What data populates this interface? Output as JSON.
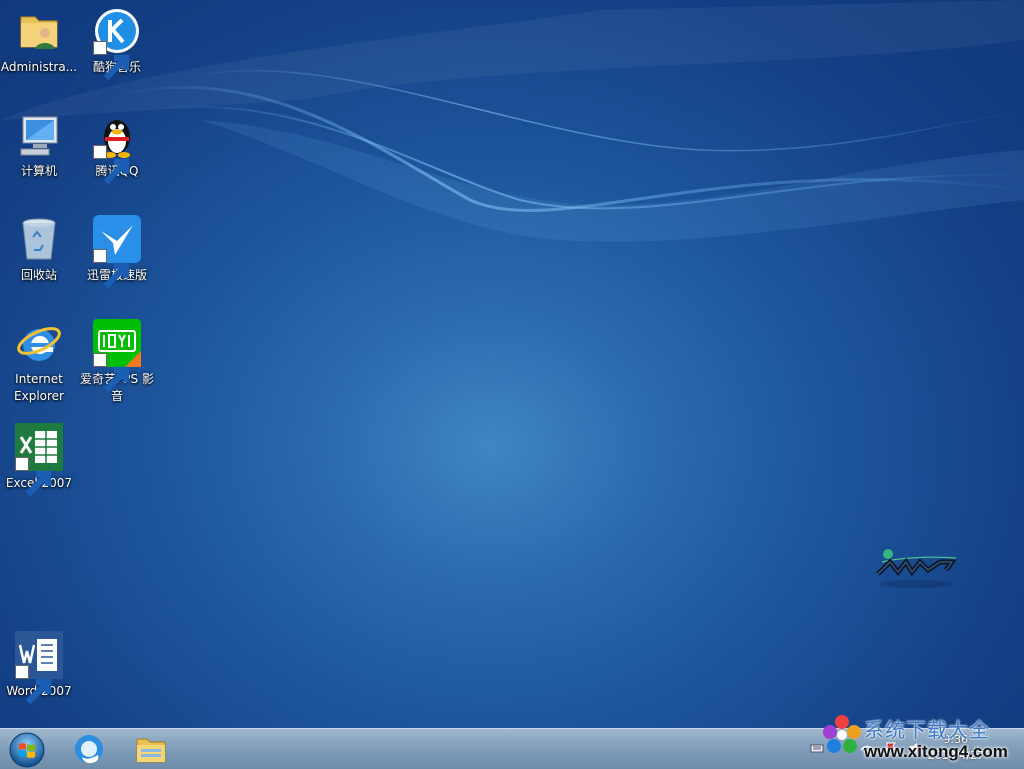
{
  "desktop": {
    "icons": [
      {
        "label": "Administra...",
        "icon": "user-folder-icon"
      },
      {
        "label": "酷狗音乐",
        "icon": "kugou-music-icon"
      },
      {
        "label": "计算机",
        "icon": "computer-icon"
      },
      {
        "label": "腾讯QQ",
        "icon": "qq-penguin-icon"
      },
      {
        "label": "回收站",
        "icon": "recycle-bin-icon"
      },
      {
        "label": "迅雷极速版",
        "icon": "xunlei-bird-icon"
      },
      {
        "label": "Internet Explorer",
        "icon": "internet-explorer-icon"
      },
      {
        "label": "爱奇艺PPS 影音",
        "icon": "iqiyi-icon"
      },
      {
        "label": "Excel 2007",
        "icon": "excel-icon"
      },
      {
        "label": "Word 2007",
        "icon": "word-icon"
      }
    ]
  },
  "taskbar": {
    "start_icon": "windows-start-orb-icon",
    "pinned": [
      {
        "icon": "browser-icon"
      },
      {
        "icon": "file-explorer-icon"
      }
    ],
    "clock": {
      "time": "9:36",
      "date": "2018/4/27"
    }
  },
  "watermark": {
    "title": "系统下载大全",
    "url": "www.xitong4.com"
  },
  "colors": {
    "wallpaper": "#1d559c",
    "taskbar": "#7f9cb8"
  }
}
